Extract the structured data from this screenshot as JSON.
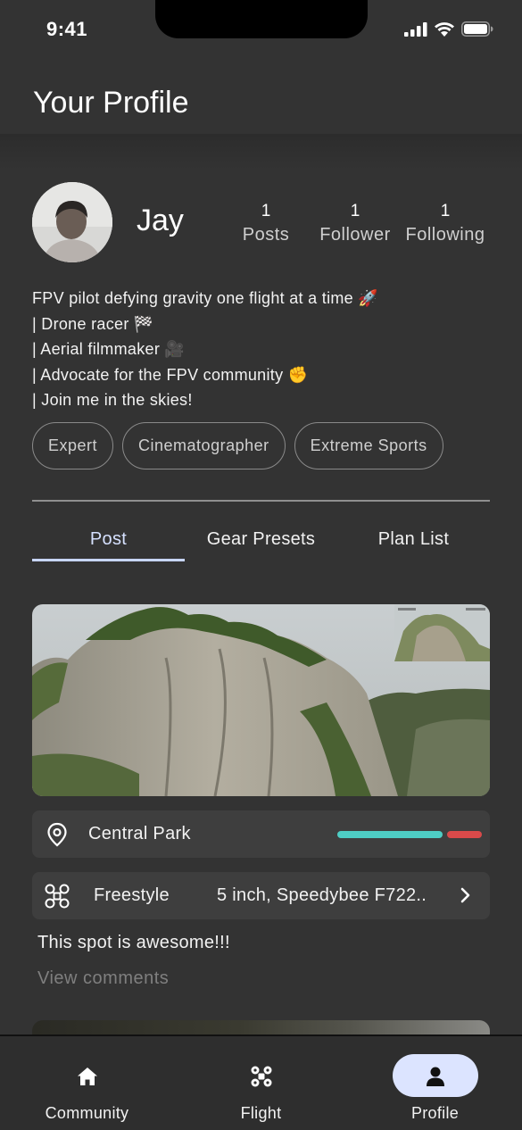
{
  "status_bar": {
    "time": "9:41"
  },
  "header": {
    "title": "Your Profile"
  },
  "profile": {
    "name": "Jay",
    "stats": [
      {
        "count": "1",
        "label": "Posts"
      },
      {
        "count": "1",
        "label": "Follower"
      },
      {
        "count": "1",
        "label": "Following"
      }
    ],
    "bio": [
      "FPV pilot defying gravity one flight at a time 🚀",
      "| Drone racer 🏁",
      "| Aerial filmmaker 🎥",
      "| Advocate for the FPV community ✊",
      "| Join me in the skies!"
    ],
    "tags": [
      "Expert",
      "Cinematographer",
      "Extreme Sports"
    ]
  },
  "tabs": [
    {
      "label": "Post",
      "active": true
    },
    {
      "label": "Gear Presets",
      "active": false
    },
    {
      "label": "Plan List",
      "active": false
    }
  ],
  "post": {
    "location": "Central Park",
    "style": "Freestyle",
    "gear": "5 inch, Speedybee F722..",
    "caption": "This spot is awesome!!!",
    "view_comments": "View comments",
    "colors": {
      "bar_primary": "#4ecdc4",
      "bar_secondary": "#d94a4a"
    }
  },
  "bottom_nav": [
    {
      "label": "Community",
      "icon": "home-icon",
      "active": false
    },
    {
      "label": "Flight",
      "icon": "drone-icon",
      "active": false
    },
    {
      "label": "Profile",
      "icon": "person-icon",
      "active": true
    }
  ]
}
